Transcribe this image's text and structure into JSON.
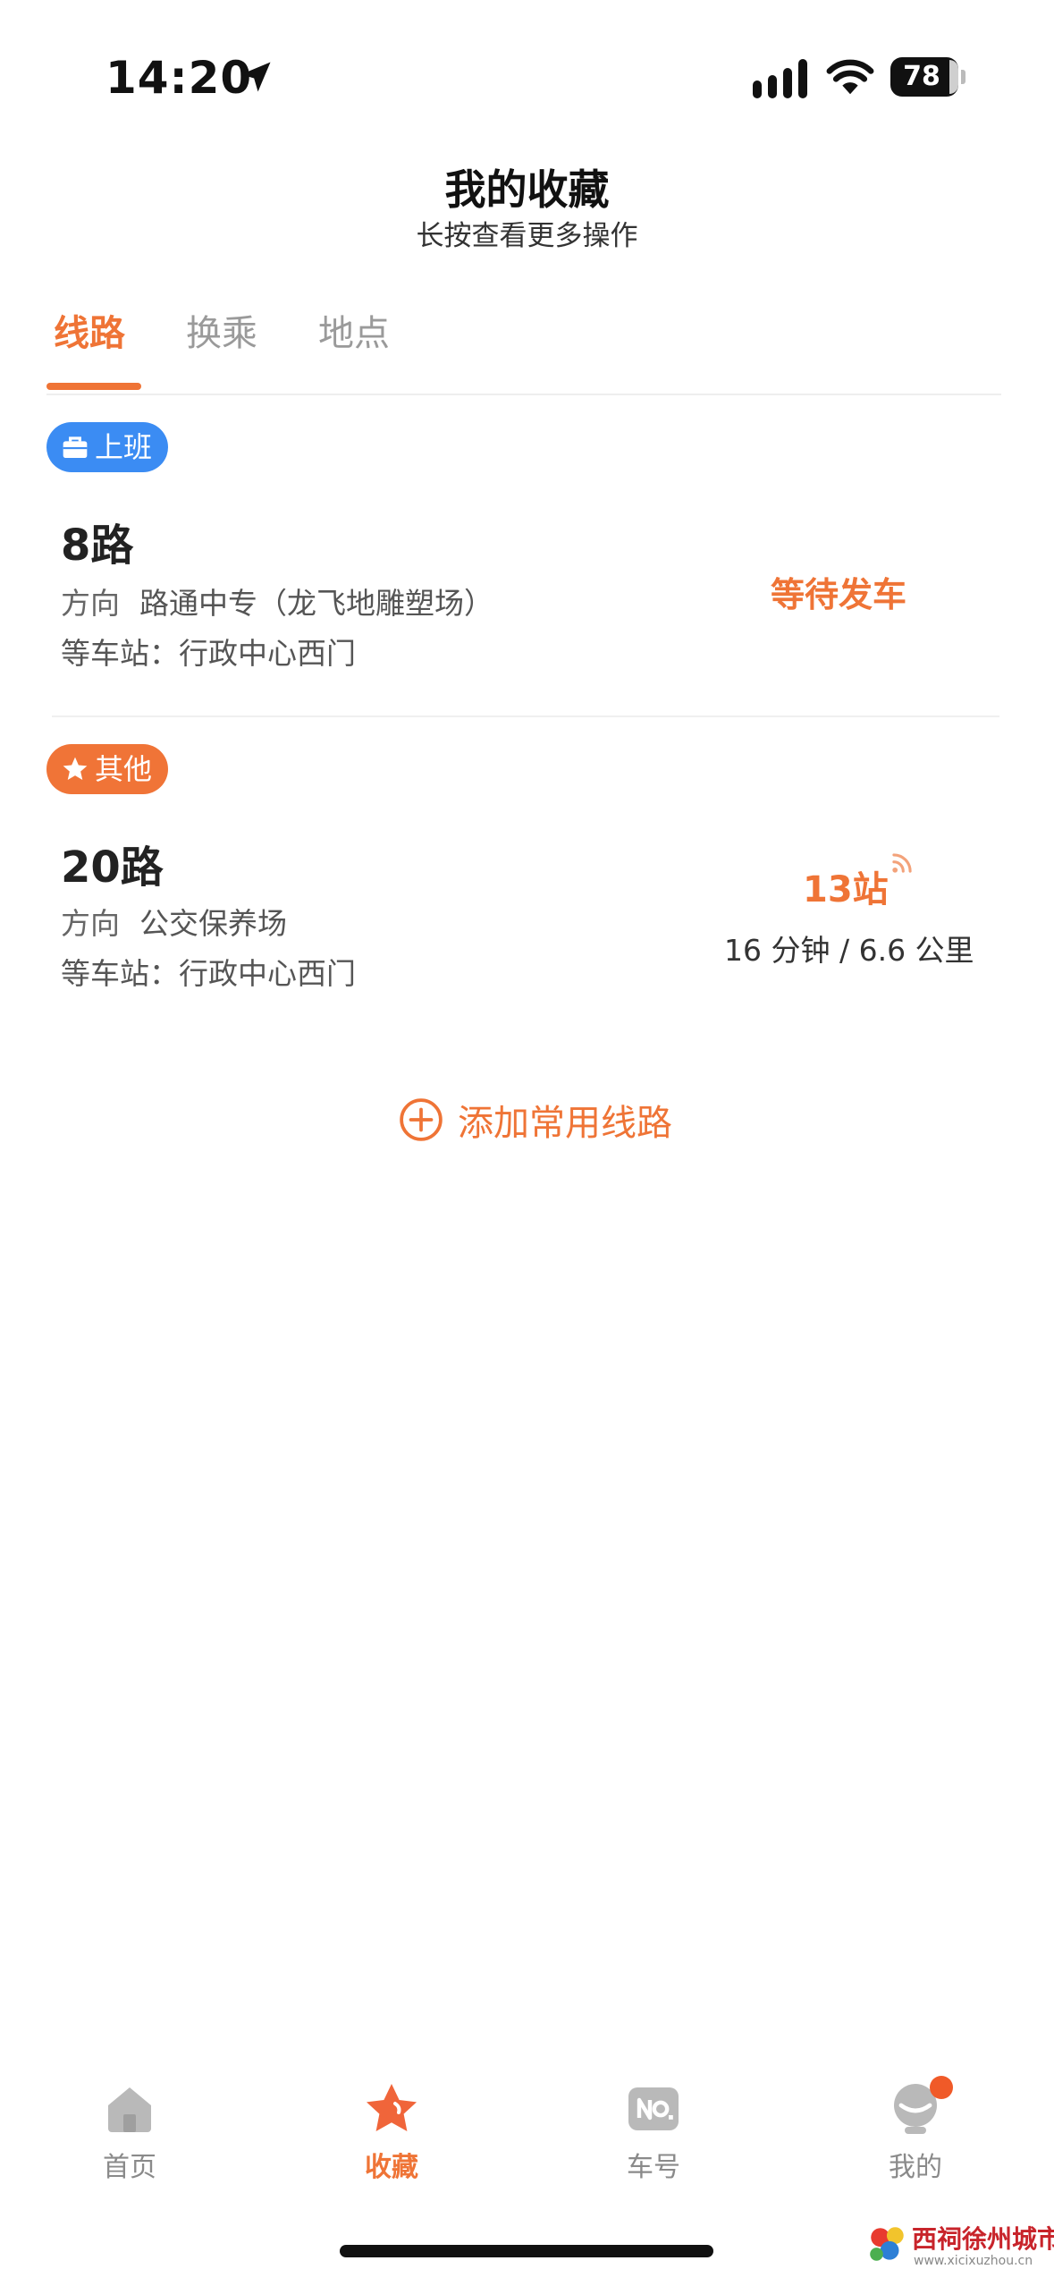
{
  "status_bar": {
    "time": "14:20",
    "battery": "78"
  },
  "header": {
    "title": "我的收藏",
    "subtitle": "长按查看更多操作"
  },
  "tabs": [
    {
      "label": "线路",
      "active": true
    },
    {
      "label": "换乘",
      "active": false
    },
    {
      "label": "地点",
      "active": false
    }
  ],
  "favorites": [
    {
      "badge": "上班",
      "badge_color": "#3b8cf3",
      "badge_icon": "briefcase-icon",
      "route": "8路",
      "direction_label": "方向",
      "direction": "路通中专（龙飞地雕塑场）",
      "station_text": "等车站：行政中心西门",
      "status": "等待发车"
    },
    {
      "badge": "其他",
      "badge_color": "#f07437",
      "badge_icon": "star-icon",
      "route": "20路",
      "direction_label": "方向",
      "direction": "公交保养场",
      "station_text": "等车站：行政中心西门",
      "stops": "13站",
      "eta": "16 分钟 / 6.6 公里"
    }
  ],
  "add_route_label": "添加常用线路",
  "bottom_nav": [
    {
      "label": "首页",
      "icon": "home-icon",
      "active": false
    },
    {
      "label": "收藏",
      "icon": "star-icon",
      "active": true
    },
    {
      "label": "车号",
      "icon": "bus-number-icon",
      "active": false
    },
    {
      "label": "我的",
      "icon": "profile-icon",
      "active": false
    }
  ],
  "colors": {
    "accent": "#ef7436",
    "badge_blue": "#3b8cf3",
    "notification": "#f05a28"
  },
  "watermark": {
    "text": "西祠徐州城市站",
    "url_text": "www.xicixuzhou.cn"
  }
}
